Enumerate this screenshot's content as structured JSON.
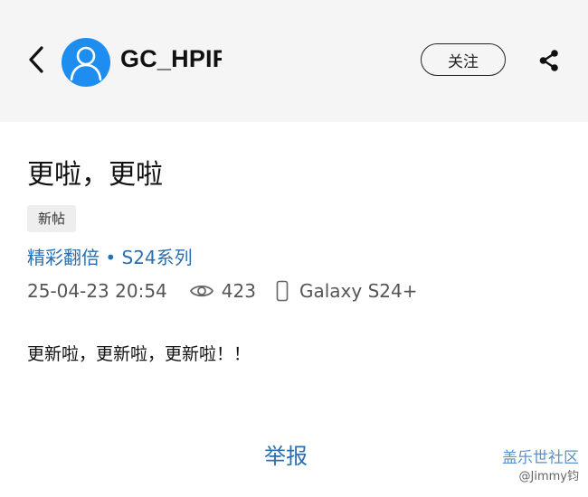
{
  "header": {
    "username": "GC_HPIFO",
    "follow_label": "关注"
  },
  "post": {
    "title": "更啦，更啦",
    "tag": "新帖",
    "category": "精彩翻倍 • S24系列",
    "timestamp": "25-04-23 20:54",
    "views": "423",
    "device": "Galaxy S24+",
    "content": "更新啦，更新啦，更新啦！！"
  },
  "footer": {
    "report_label": "举报"
  },
  "watermark": {
    "name": "盖乐世社区",
    "user": "@Jimmy钧"
  },
  "colors": {
    "header_bg": "#f5f5f5",
    "avatar_bg": "#1e8df0",
    "link": "#2a6fb0"
  },
  "icons": {
    "back": "chevron-left-icon",
    "avatar": "user-icon",
    "share": "share-icon",
    "views": "eye-icon",
    "device": "phone-icon"
  }
}
